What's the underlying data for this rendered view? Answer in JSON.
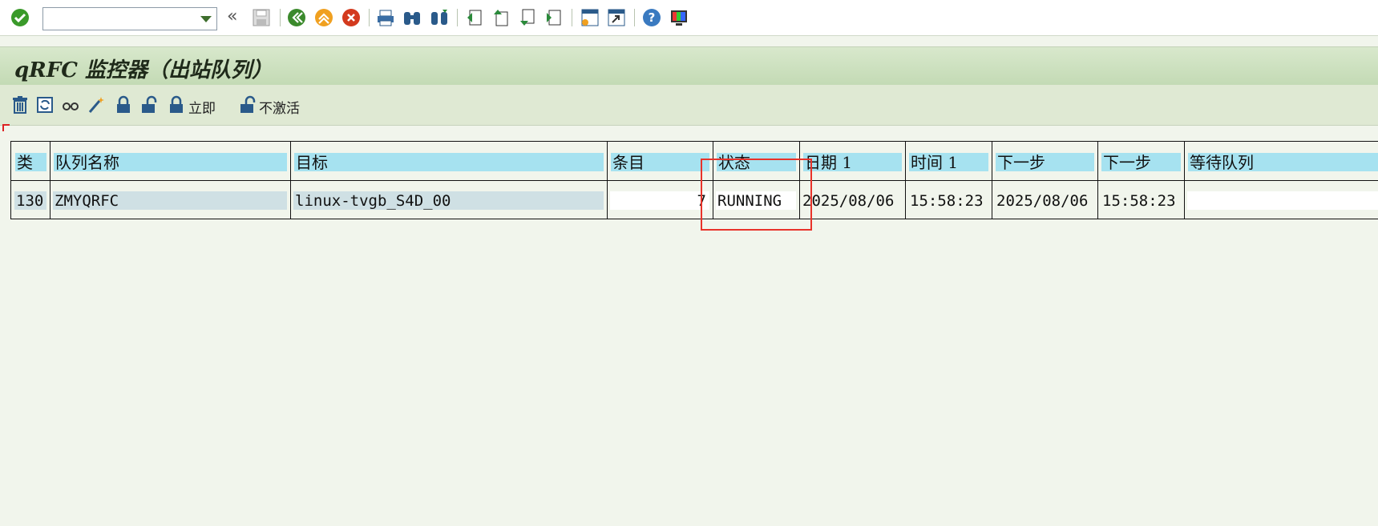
{
  "toolbar": {
    "command_value": "",
    "icons": [
      "enter-icon",
      "back-chevron-icon",
      "save-icon",
      "back-icon",
      "exit-icon",
      "cancel-icon",
      "print-icon",
      "find-icon",
      "find-next-icon",
      "first-page-icon",
      "previous-page-icon",
      "next-page-icon",
      "last-page-icon",
      "create-session-icon",
      "shortcut-icon",
      "help-icon",
      "customize-layout-icon"
    ]
  },
  "title": "qRFC 监控器（出站队列）",
  "app_toolbar": {
    "activate_label": "立即",
    "deactivate_label": "不激活"
  },
  "table": {
    "headers": [
      "类",
      "队列名称",
      "目标",
      "条目",
      "状态",
      "日期 1",
      "时间 1",
      "下一步",
      "下一步",
      "等待队列"
    ],
    "rows": [
      [
        "130",
        "ZMYQRFC",
        "linux-tvgb_S4D_00",
        "7",
        "RUNNING",
        "2025/08/06",
        "15:58:23",
        "2025/08/06",
        "15:58:23",
        ""
      ]
    ]
  },
  "colors": {
    "header_cell": "#a6e2f0",
    "highlight_box": "#e8332a",
    "title_bar": "#c3dab4",
    "background": "#f1f5ec"
  }
}
